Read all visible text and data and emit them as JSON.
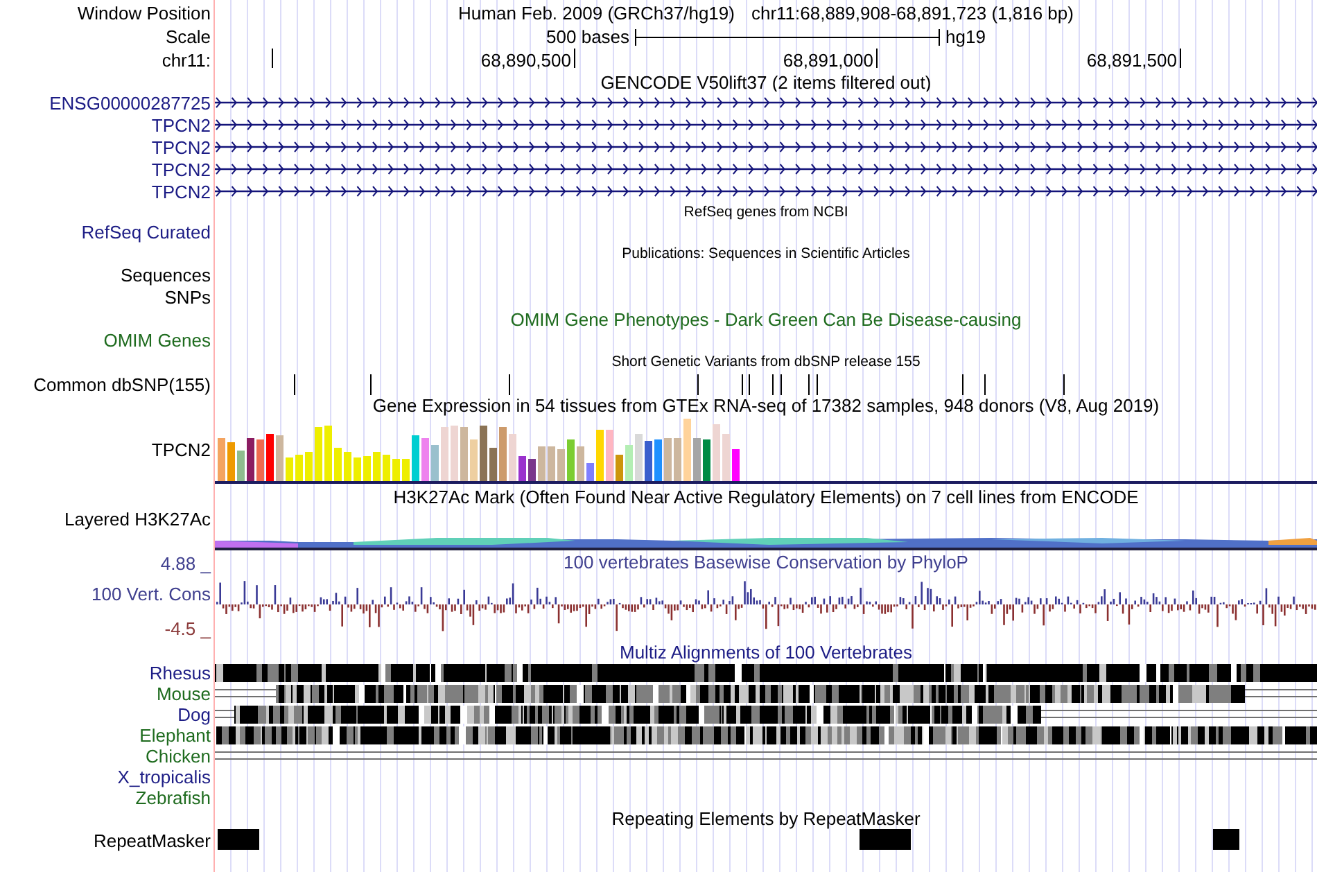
{
  "ruler": {
    "window_label": "Window Position",
    "assembly": "Human Feb. 2009 (GRCh37/hg19)",
    "position": "chr11:68,889,908-68,891,723 (1,816 bp)",
    "scale_label": "Scale",
    "scale_length": "500 bases",
    "scale_db": "hg19",
    "chrom_label": "chr11:",
    "ticks": [
      "68,890,500",
      "68,891,000",
      "68,891,500"
    ]
  },
  "tracks": [
    {
      "kind": "genes",
      "title": "GENCODE V50lift37 (2 items filtered out)",
      "labels": [
        {
          "text": "ENSG00000287725",
          "color": "#1c1c85"
        },
        {
          "text": "TPCN2",
          "color": "#1c1c85"
        },
        {
          "text": "TPCN2",
          "color": "#1c1c85"
        },
        {
          "text": "TPCN2",
          "color": "#1c1c85"
        },
        {
          "text": "TPCN2",
          "color": "#1c1c85"
        }
      ]
    },
    {
      "kind": "refseq",
      "title": "RefSeq genes from NCBI",
      "labels": [
        {
          "text": "RefSeq Curated",
          "color": "#1c1c85"
        }
      ]
    },
    {
      "kind": "pubs",
      "title": "Publications: Sequences in Scientific Articles",
      "labels": [
        {
          "text": "Sequences",
          "color": "#000000"
        },
        {
          "text": "SNPs",
          "color": "#000000"
        }
      ]
    },
    {
      "kind": "omim",
      "title": "OMIM Gene Phenotypes - Dark Green Can Be Disease-causing",
      "labels": [
        {
          "text": "OMIM Genes",
          "color": "#1e6b1e"
        }
      ]
    },
    {
      "kind": "snps",
      "title": "Short Genetic Variants from dbSNP release 155",
      "labels": [
        {
          "text": "Common dbSNP(155)",
          "color": "#000000"
        }
      ]
    },
    {
      "kind": "gtex",
      "title": "Gene Expression in 54 tissues from GTEx RNA-seq of 17382 samples, 948 donors (V8, Aug 2019)",
      "labels": [
        {
          "text": "TPCN2",
          "color": "#000000"
        }
      ]
    },
    {
      "kind": "h3k27ac",
      "title": "H3K27Ac Mark (Often Found Near Active Regulatory Elements) on 7 cell lines from ENCODE",
      "labels": [
        {
          "text": "Layered H3K27Ac",
          "color": "#000000"
        }
      ]
    },
    {
      "kind": "conservation",
      "title": "100 vertebrates Basewise Conservation by PhyloP",
      "labels": [
        {
          "text": "4.88 _",
          "color": "#40408f"
        },
        {
          "text": "100 Vert. Cons",
          "color": "#40408f"
        },
        {
          "text": "-4.5 _",
          "color": "#8b3a3a"
        }
      ]
    },
    {
      "kind": "multiz",
      "title": "Multiz Alignments of 100 Vertebrates",
      "labels": [
        {
          "text": "Rhesus",
          "color": "#1c1c85"
        },
        {
          "text": "Mouse",
          "color": "#1e6b1e"
        },
        {
          "text": "Dog",
          "color": "#1c1c85"
        },
        {
          "text": "Elephant",
          "color": "#1e6b1e"
        },
        {
          "text": "Chicken",
          "color": "#1e6b1e"
        },
        {
          "text": "X_tropicalis",
          "color": "#1c1c85"
        },
        {
          "text": "Zebrafish",
          "color": "#1e6b1e"
        }
      ]
    },
    {
      "kind": "repeats",
      "title": "Repeating Elements by RepeatMasker",
      "labels": [
        {
          "text": "RepeatMasker",
          "color": "#000000"
        }
      ]
    }
  ]
}
